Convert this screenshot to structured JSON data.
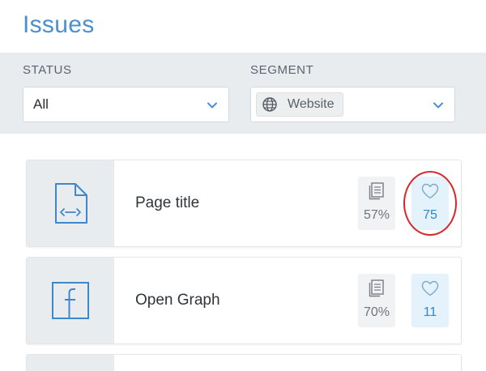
{
  "page": {
    "title": "Issues"
  },
  "filters": {
    "status": {
      "label": "STATUS",
      "value": "All"
    },
    "segment": {
      "label": "SEGMENT",
      "value": "Website",
      "icon": "globe-icon"
    }
  },
  "colors": {
    "accent": "#4a8fd0",
    "like_blue": "#2a8ad0",
    "highlight": "#d9262a"
  },
  "issues": [
    {
      "title": "Page title",
      "icon": "code-file-icon",
      "percent": "57%",
      "likes": "75"
    },
    {
      "title": "Open Graph",
      "icon": "facebook-icon",
      "percent": "70%",
      "likes": "11"
    }
  ]
}
